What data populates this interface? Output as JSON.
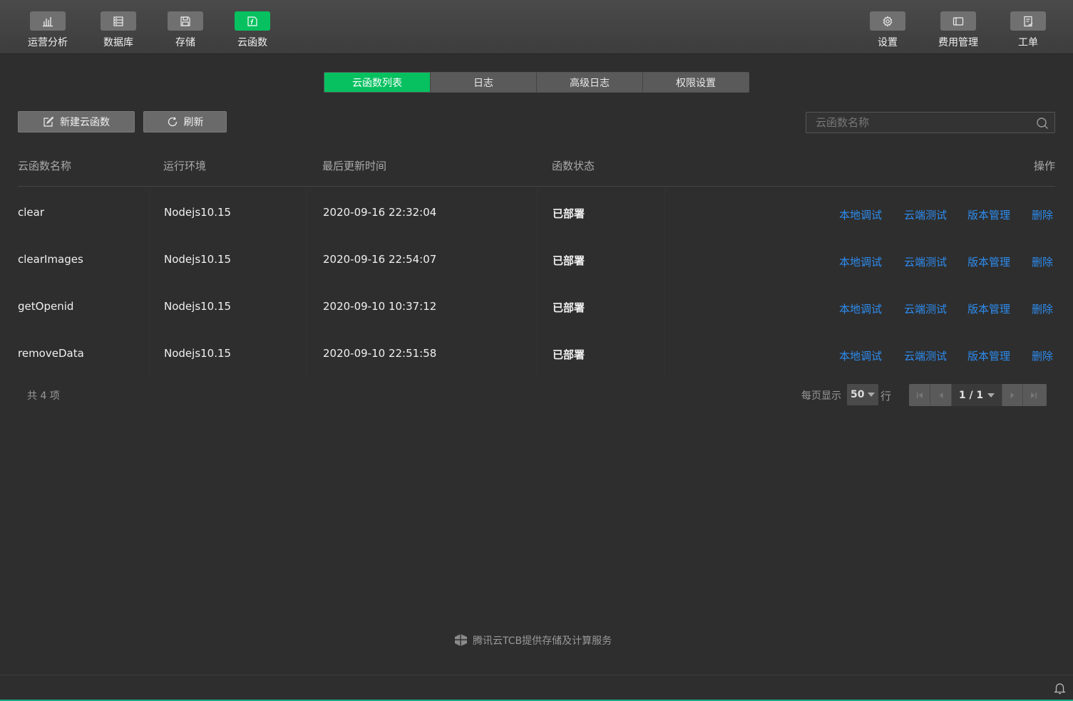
{
  "toolbar": {
    "left": [
      {
        "label": "运营分析",
        "icon": "bar-chart-icon"
      },
      {
        "label": "数据库",
        "icon": "database-icon"
      },
      {
        "label": "存储",
        "icon": "save-icon"
      },
      {
        "label": "云函数",
        "icon": "function-icon",
        "active": true
      }
    ],
    "right": [
      {
        "label": "设置",
        "icon": "gear-icon"
      },
      {
        "label": "费用管理",
        "icon": "card-icon"
      },
      {
        "label": "工单",
        "icon": "ticket-icon"
      }
    ]
  },
  "tabs": [
    {
      "label": "云函数列表",
      "active": true
    },
    {
      "label": "日志"
    },
    {
      "label": "高级日志"
    },
    {
      "label": "权限设置"
    }
  ],
  "actions": {
    "new_label": "新建云函数",
    "refresh_label": "刷新"
  },
  "search": {
    "placeholder": "云函数名称",
    "value": ""
  },
  "table": {
    "headers": {
      "name": "云函数名称",
      "runtime": "运行环境",
      "updated": "最后更新时间",
      "status": "函数状态",
      "ops": "操作"
    },
    "op_labels": [
      "本地调试",
      "云端测试",
      "版本管理",
      "删除"
    ],
    "rows": [
      {
        "name": "clear",
        "runtime": "Nodejs10.15",
        "updated": "2020-09-16 22:32:04",
        "status": "已部署"
      },
      {
        "name": "clearImages",
        "runtime": "Nodejs10.15",
        "updated": "2020-09-16 22:54:07",
        "status": "已部署"
      },
      {
        "name": "getOpenid",
        "runtime": "Nodejs10.15",
        "updated": "2020-09-10 10:37:12",
        "status": "已部署"
      },
      {
        "name": "removeData",
        "runtime": "Nodejs10.15",
        "updated": "2020-09-10 22:51:58",
        "status": "已部署"
      }
    ]
  },
  "pagination": {
    "total_text": "共 4 项",
    "per_page_label": "每页显示",
    "per_page_value": "50",
    "per_page_suffix": "行",
    "page_text": "1 / 1"
  },
  "footer": {
    "brand_text": "腾讯云TCB提供存储及计算服务"
  },
  "colors": {
    "accent": "#07c160",
    "link": "#2d8cf0",
    "background": "#2e2e2e"
  }
}
